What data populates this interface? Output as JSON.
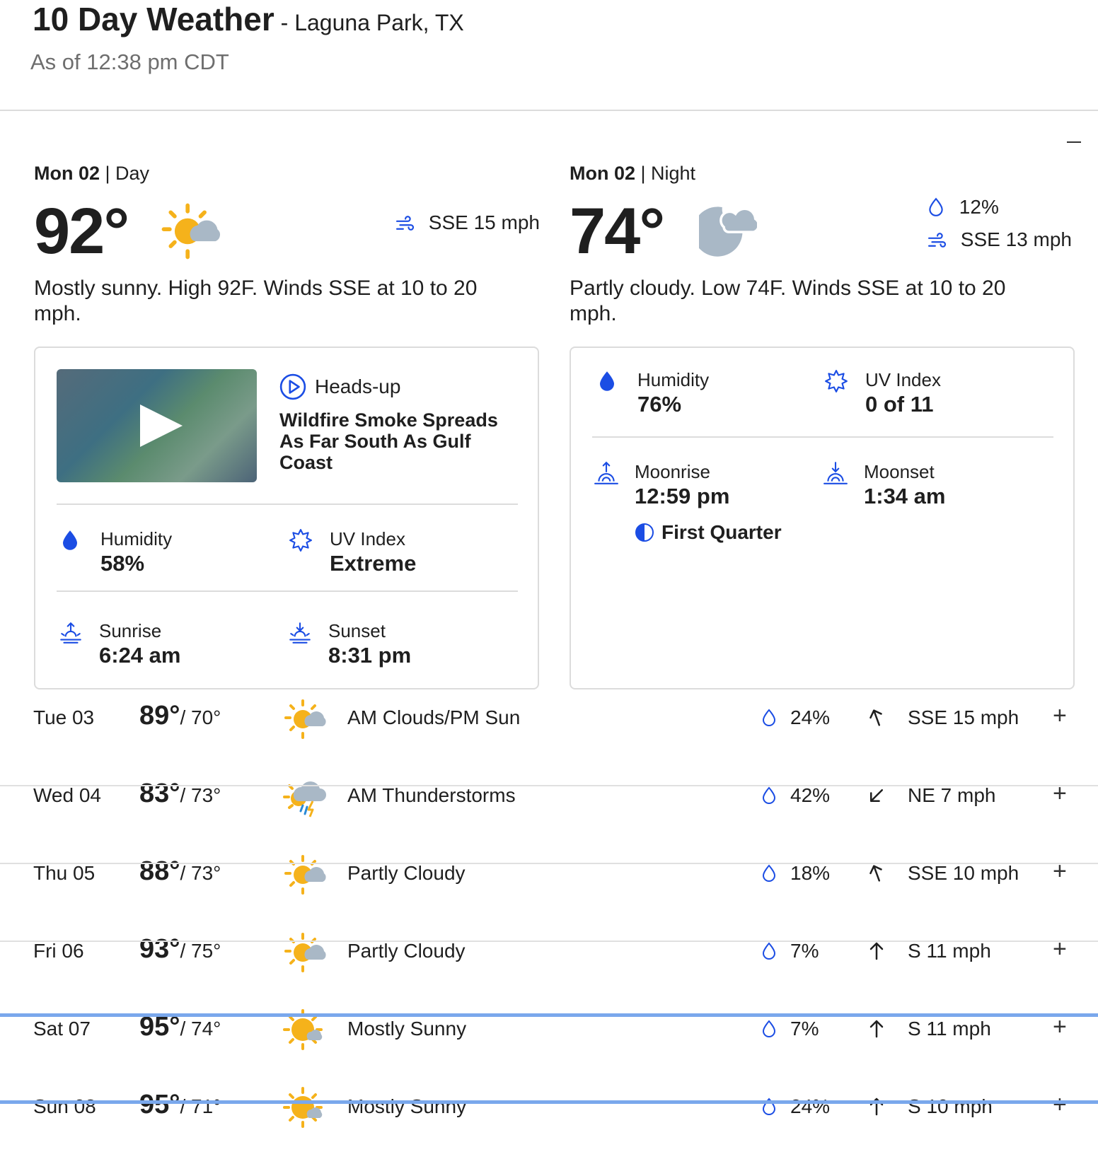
{
  "header": {
    "title": "10 Day Weather",
    "location": " - Laguna Park, TX",
    "as_of": "As of 12:38 pm CDT"
  },
  "day": {
    "date": "Mon 02",
    "part": " | Day",
    "temp": "92°",
    "icon": "partly-sunny-icon",
    "wind": "SSE 15 mph",
    "narrative": "Mostly sunny. High 92F. Winds SSE at 10 to 20 mph.",
    "video": {
      "kicker": "Heads-up",
      "headline": "Wildfire Smoke Spreads As Far South As Gulf Coast"
    },
    "humidity_label": "Humidity",
    "humidity": "58%",
    "uv_label": "UV Index",
    "uv": "Extreme",
    "sunrise_label": "Sunrise",
    "sunrise": "6:24 am",
    "sunset_label": "Sunset",
    "sunset": "8:31 pm"
  },
  "night": {
    "date": "Mon 02",
    "part": " | Night",
    "temp": "74°",
    "icon": "partly-cloudy-night-icon",
    "precip": "12%",
    "wind": "SSE 13 mph",
    "narrative": "Partly cloudy. Low 74F. Winds SSE at 10 to 20 mph.",
    "humidity_label": "Humidity",
    "humidity": "76%",
    "uv_label": "UV Index",
    "uv": "0 of 11",
    "moonrise_label": "Moonrise",
    "moonrise": "12:59 pm",
    "moonset_label": "Moonset",
    "moonset": "1:34 am",
    "moon_phase": "First Quarter"
  },
  "forecast": [
    {
      "day": "Tue 03",
      "hi": "89°",
      "lo": "/ 70°",
      "icon": "partly-cloudy-day-icon",
      "cond": "AM Clouds/PM Sun",
      "precip": "24%",
      "wind_dir": "SSE",
      "wind": "SSE 15 mph"
    },
    {
      "day": "Wed 04",
      "hi": "83°",
      "lo": "/ 73°",
      "icon": "thunderstorm-icon",
      "cond": "AM Thunderstorms",
      "precip": "42%",
      "wind_dir": "NE",
      "wind": "NE 7 mph"
    },
    {
      "day": "Thu 05",
      "hi": "88°",
      "lo": "/ 73°",
      "icon": "partly-cloudy-day-icon",
      "cond": "Partly Cloudy",
      "precip": "18%",
      "wind_dir": "SSE",
      "wind": "SSE 10 mph"
    },
    {
      "day": "Fri 06",
      "hi": "93°",
      "lo": "/ 75°",
      "icon": "partly-cloudy-day-icon",
      "cond": "Partly Cloudy",
      "precip": "7%",
      "wind_dir": "S",
      "wind": "S 11 mph"
    },
    {
      "day": "Sat 07",
      "hi": "95°",
      "lo": "/ 74°",
      "icon": "mostly-sunny-icon",
      "cond": "Mostly Sunny",
      "precip": "7%",
      "wind_dir": "S",
      "wind": "S 11 mph"
    },
    {
      "day": "Sun 08",
      "hi": "95°",
      "lo": "/ 71°",
      "icon": "mostly-sunny-icon",
      "cond": "Mostly Sunny",
      "precip": "24%",
      "wind_dir": "S",
      "wind": "S 10 mph"
    }
  ],
  "colors": {
    "accent_blue": "#1b4de4",
    "sun": "#f5b21b",
    "cloud": "#a9b8c6",
    "divider_highlight": "#7aa8ec"
  }
}
